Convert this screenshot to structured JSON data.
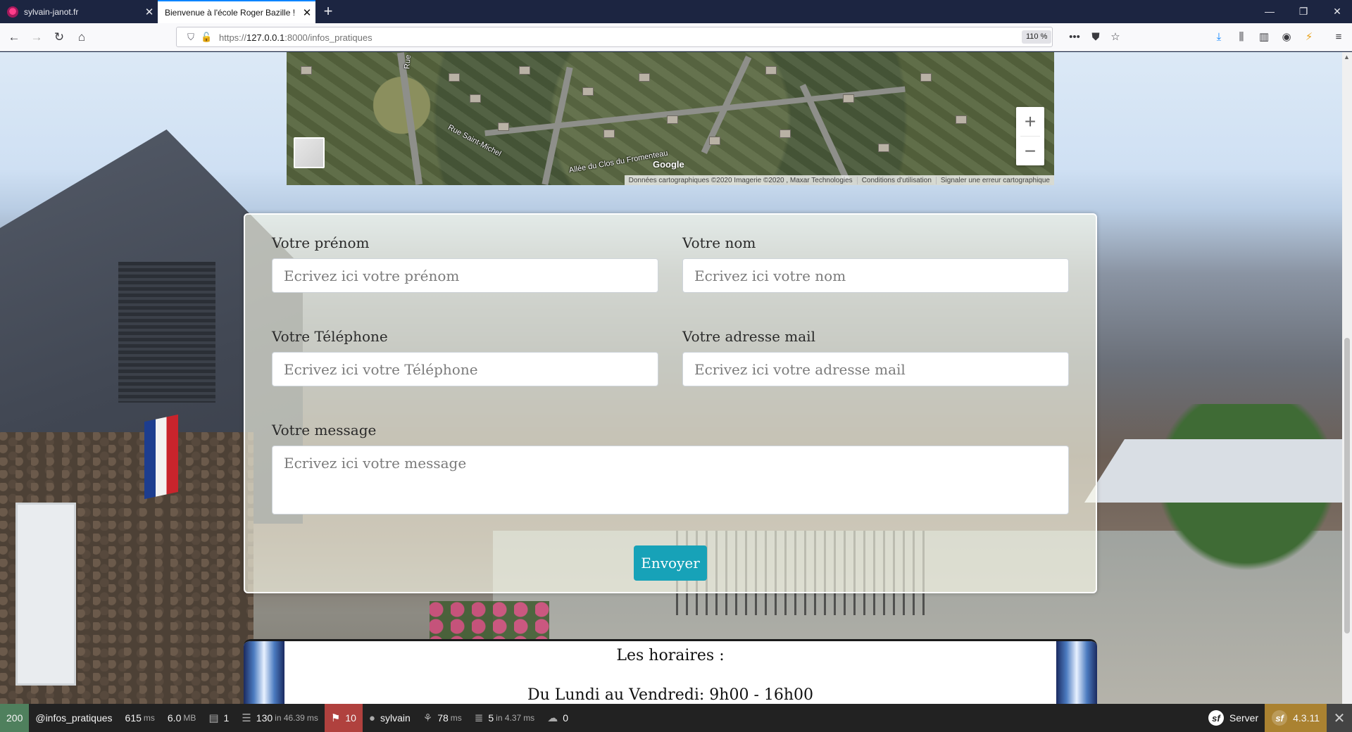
{
  "browser": {
    "tabs": [
      {
        "title": "sylvain-janot.fr",
        "active": false
      },
      {
        "title": "Bienvenue à l'école Roger Bazille !",
        "active": true
      }
    ],
    "new_tab_icon": "plus-icon",
    "url_prefix": "https://",
    "url_host": "127.0.0.1",
    "url_rest": ":8000/infos_pratiques",
    "zoom": "110 %"
  },
  "map": {
    "labels": [
      "Rue Saint-Michel",
      "Allée du Clos du Fromenteau",
      "Rue"
    ],
    "logo": "Google",
    "attribution": [
      "Données cartographiques ©2020 Imagerie ©2020 , Maxar Technologies",
      "Conditions d'utilisation",
      "Signaler une erreur cartographique"
    ],
    "zoom_in": "+",
    "zoom_out": "−"
  },
  "form": {
    "prenom": {
      "label": "Votre prénom",
      "placeholder": "Ecrivez ici votre prénom"
    },
    "nom": {
      "label": "Votre nom",
      "placeholder": "Ecrivez ici votre nom"
    },
    "telephone": {
      "label": "Votre Téléphone",
      "placeholder": "Ecrivez ici votre Téléphone"
    },
    "mail": {
      "label": "Votre adresse mail",
      "placeholder": "Ecrivez ici votre adresse mail"
    },
    "message": {
      "label": "Votre message",
      "placeholder": "Ecrivez ici votre message"
    },
    "submit": "Envoyer",
    "accent": "#17a2b8"
  },
  "horaires": {
    "title": "Les horaires :",
    "line": "Du Lundi au Vendredi: 9h00 - 16h00"
  },
  "toolbar": {
    "status": "200",
    "route": "@infos_pratiques",
    "time": "615",
    "time_unit": "ms",
    "memory": "6.0",
    "memory_unit": "MB",
    "forms": "1",
    "cache": "130",
    "cache_in": "in 46.39",
    "cache_unit": "ms",
    "twig": "10",
    "user": "sylvain",
    "perf": "78",
    "perf_unit": "ms",
    "db": "5",
    "db_in": "in 4.37",
    "db_unit": "ms",
    "ajax": "0",
    "server": "Server",
    "version": "4.3.11"
  }
}
